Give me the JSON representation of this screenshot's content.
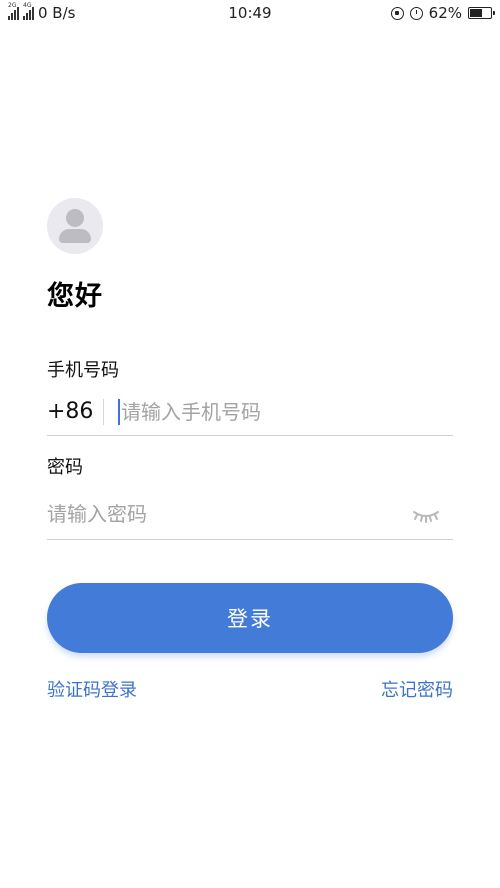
{
  "status_bar": {
    "network_tag_1": "2G",
    "network_tag_2": "4G",
    "speed": "0 B/s",
    "time": "10:49",
    "battery_percent": "62%",
    "battery_level": 0.62
  },
  "greeting": "您好",
  "phone": {
    "label": "手机号码",
    "country_code": "+86",
    "placeholder": "请输入手机号码"
  },
  "password": {
    "label": "密码",
    "placeholder": "请输入密码"
  },
  "login_button": "登录",
  "links": {
    "sms_login": "验证码登录",
    "forgot_password": "忘记密码"
  },
  "colors": {
    "accent": "#427bd8",
    "link": "#3c73c6",
    "avatar_bg": "#e9e9ef"
  }
}
